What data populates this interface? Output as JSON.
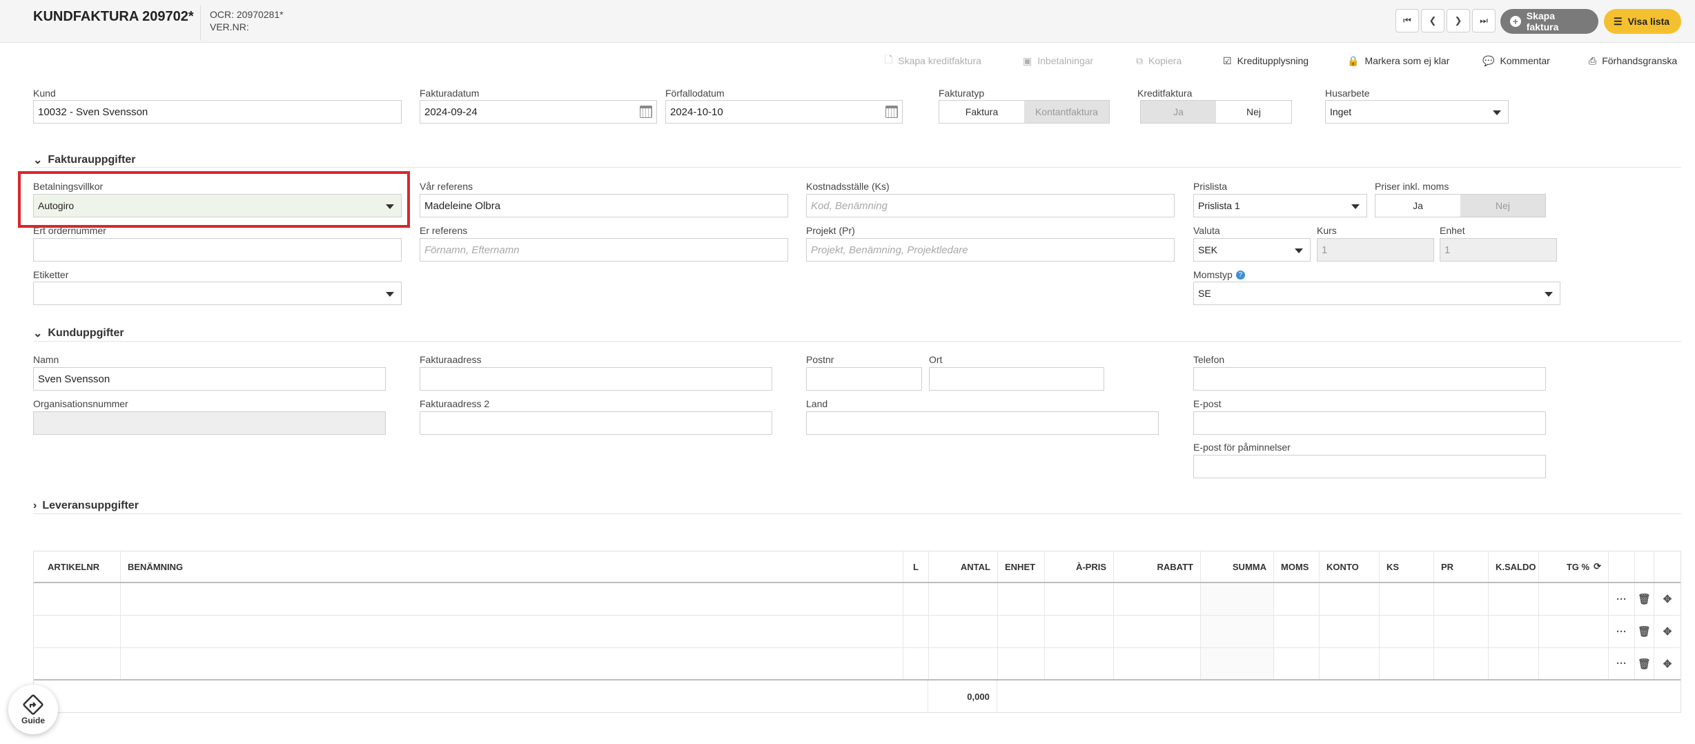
{
  "header": {
    "title": "KUNDFAKTURA 209702*",
    "ocr": "OCR: 20970281*",
    "vernr": "VER.NR:",
    "btn_create": "Skapa faktura",
    "btn_list": "Visa lista"
  },
  "toolbar": {
    "credit_invoice": "Skapa kreditfaktura",
    "payments": "Inbetalningar",
    "copy": "Kopiera",
    "credit_info": "Kreditupplysning",
    "mark_not_ready": "Markera som ej klar",
    "comment": "Kommentar",
    "preview": "Förhandsgranska"
  },
  "top": {
    "customer_label": "Kund",
    "customer_value": "10032 - Sven Svensson",
    "invoice_date_label": "Fakturadatum",
    "invoice_date": "2024-09-24",
    "due_date_label": "Förfallodatum",
    "due_date": "2024-10-10",
    "invoice_type_label": "Fakturatyp",
    "invoice_type_opt1": "Faktura",
    "invoice_type_opt2": "Kontantfaktura",
    "credit_label": "Kreditfaktura",
    "credit_yes": "Ja",
    "credit_no": "Nej",
    "house_label": "Husarbete",
    "house_value": "Inget"
  },
  "invoice_section": {
    "title": "Fakturauppgifter",
    "payment_terms_label": "Betalningsvillkor",
    "payment_terms": "Autogiro",
    "our_ref_label": "Vår referens",
    "our_ref": "Madeleine Olbra",
    "cost_center_label": "Kostnadsställe (Ks)",
    "cost_center_ph": "Kod, Benämning",
    "pricelist_label": "Prislista",
    "pricelist": "Prislista 1",
    "prices_vat_label": "Priser inkl. moms",
    "prices_vat_yes": "Ja",
    "prices_vat_no": "Nej",
    "order_no_label": "Ert ordernummer",
    "your_ref_label": "Er referens",
    "your_ref_ph": "Förnamn, Efternamn",
    "project_label": "Projekt (Pr)",
    "project_ph": "Projekt, Benämning, Projektledare",
    "currency_label": "Valuta",
    "currency": "SEK",
    "rate_label": "Kurs",
    "rate": "1",
    "unit_label": "Enhet",
    "unit": "1",
    "tags_label": "Etiketter",
    "vat_type_label": "Momstyp",
    "vat_type": "SE"
  },
  "customer_section": {
    "title": "Kunduppgifter",
    "name_label": "Namn",
    "name": "Sven Svensson",
    "address_label": "Fakturaadress",
    "zip_label": "Postnr",
    "city_label": "Ort",
    "phone_label": "Telefon",
    "org_label": "Organisationsnummer",
    "address2_label": "Fakturaadress 2",
    "country_label": "Land",
    "email_label": "E-post",
    "email_reminder_label": "E-post för påminnelser"
  },
  "delivery_section": {
    "title": "Leveransuppgifter"
  },
  "table": {
    "headers": [
      "ARTIKELNR",
      "BENÄMNING",
      "L",
      "ANTAL",
      "ENHET",
      "À-PRIS",
      "RABATT",
      "SUMMA",
      "MOMS",
      "KONTO",
      "KS",
      "PR",
      "K.SALDO",
      "TG %"
    ],
    "total": "0,000"
  },
  "guide_label": "Guide"
}
